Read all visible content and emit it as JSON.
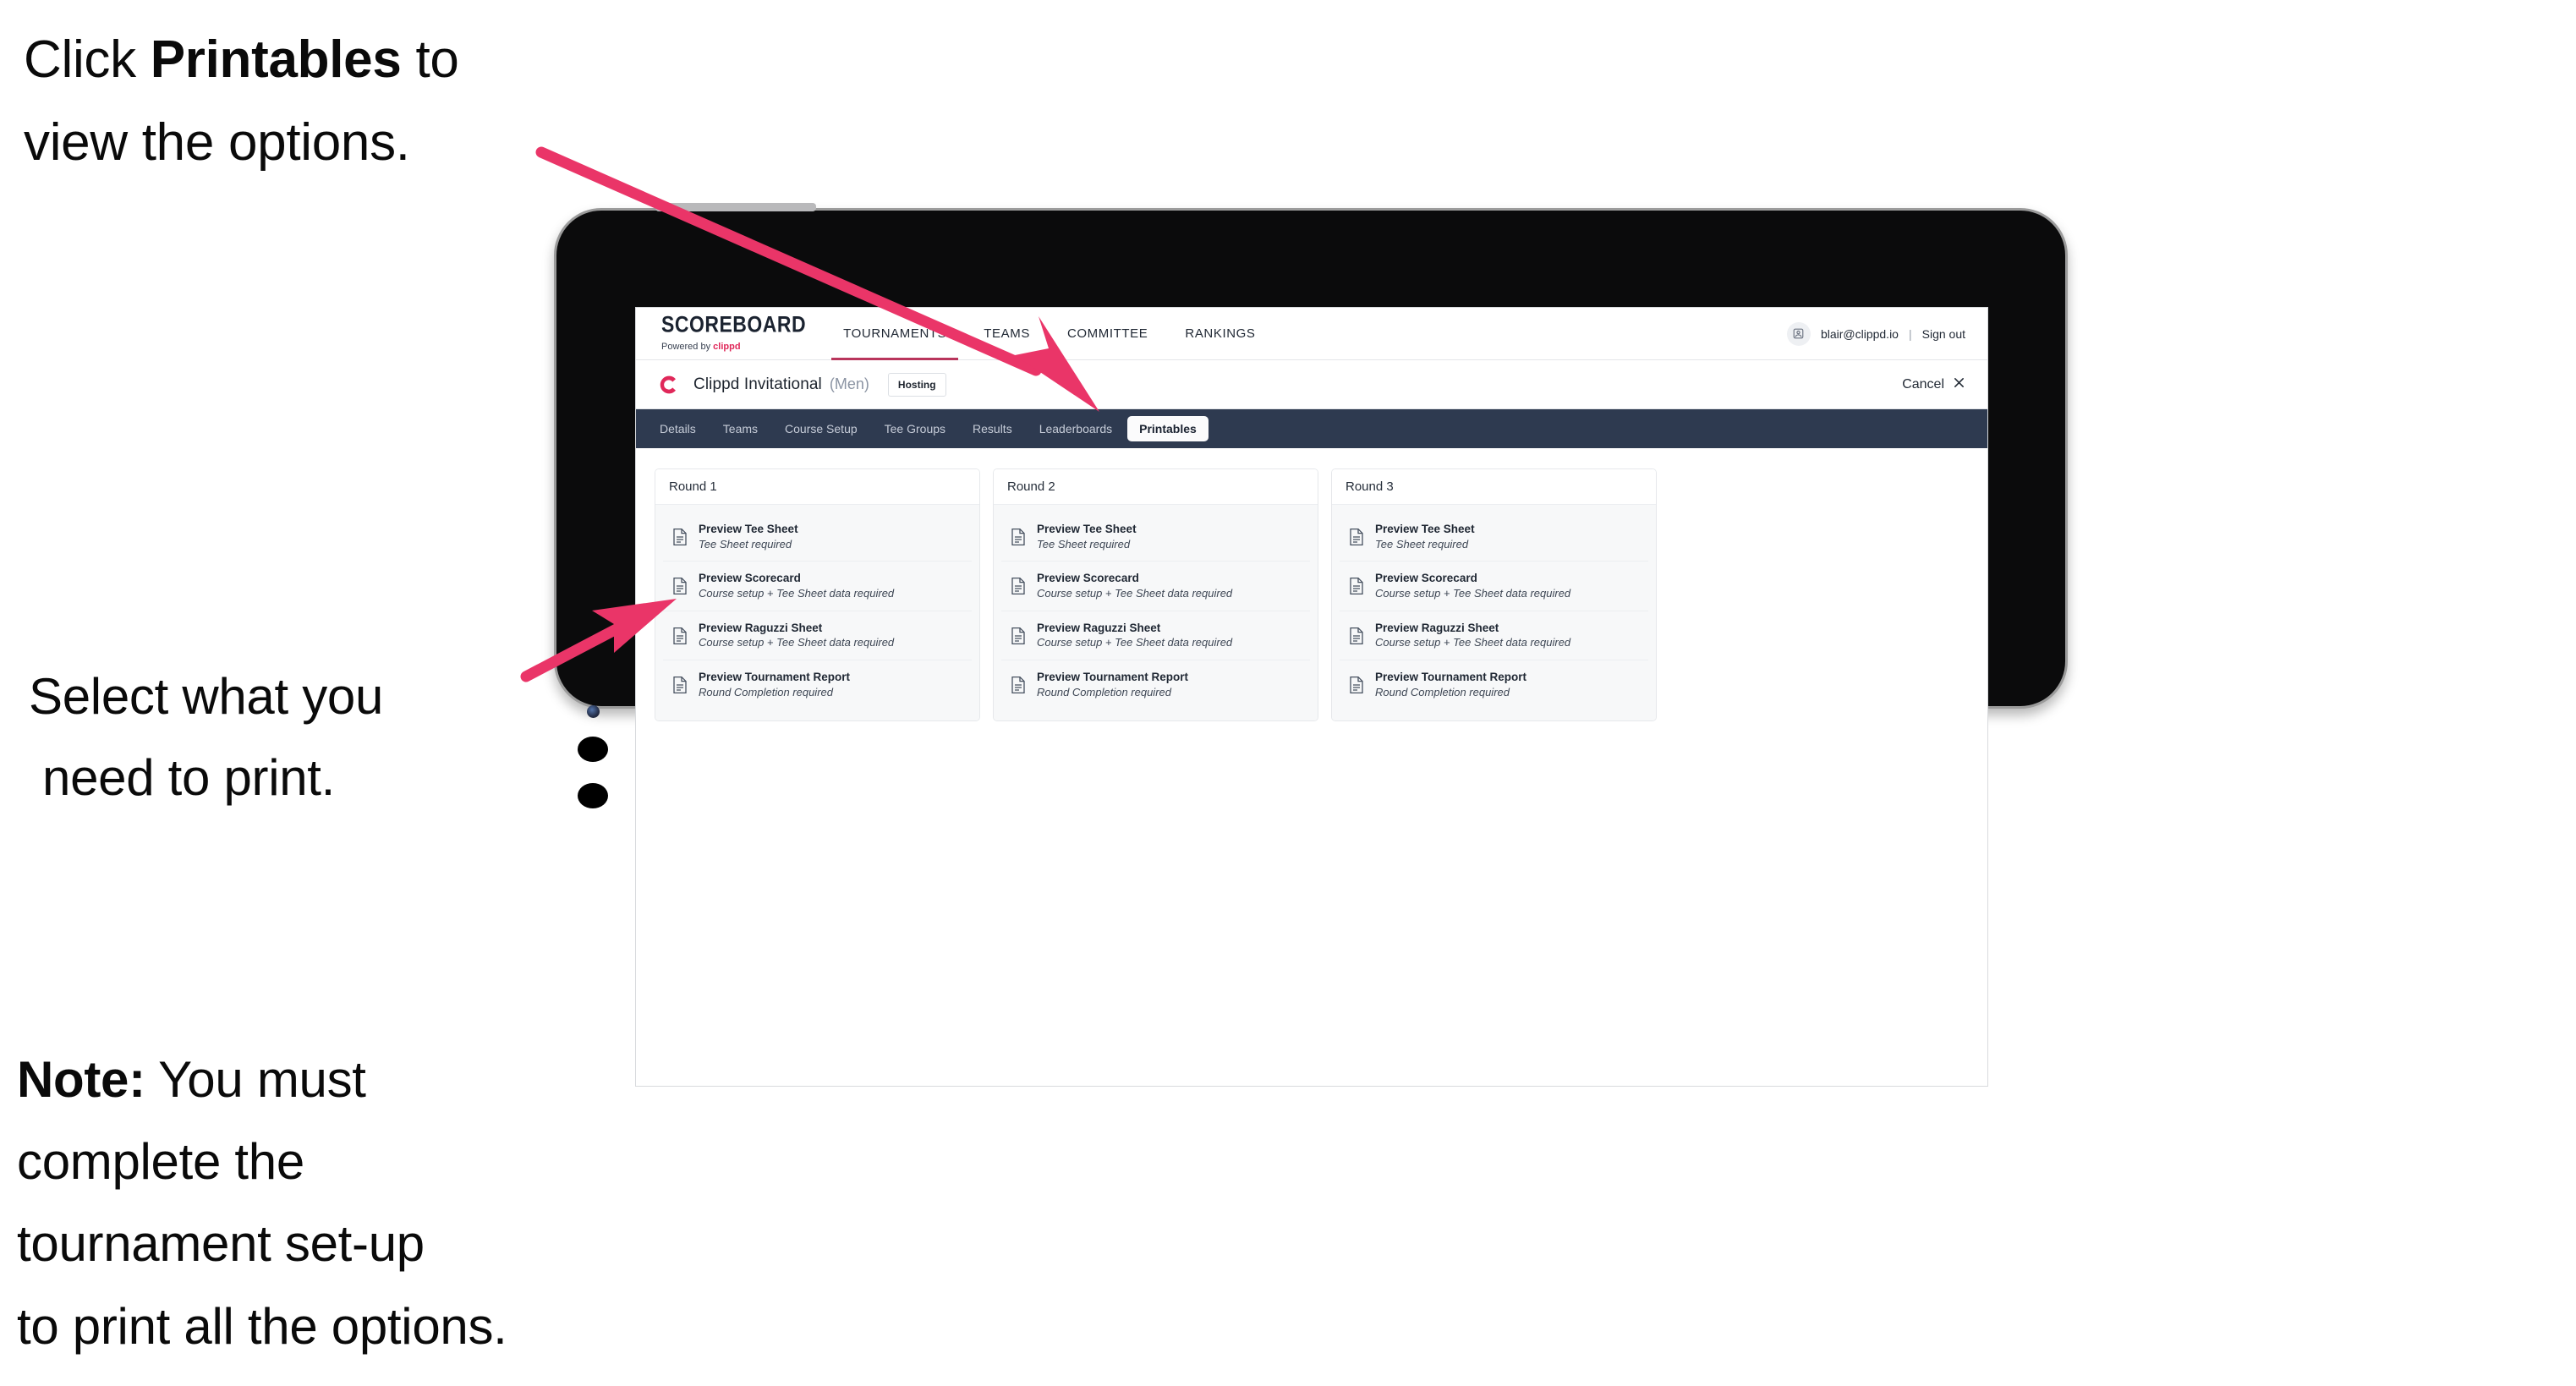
{
  "annotations": {
    "top": {
      "prefix": "Click ",
      "bold": "Printables",
      "suffix": " to",
      "line2": "view the options."
    },
    "middle": {
      "line1": "Select what you",
      "line2": "need to print."
    },
    "note": {
      "label": "Note:",
      "line1_rest": " You must",
      "line2": "complete the",
      "line3": "tournament set-up",
      "line4": "to print all the options."
    }
  },
  "app": {
    "brand": {
      "title": "SCOREBOARD",
      "sub_prefix": "Powered by ",
      "sub_brand": "clippd"
    },
    "top_nav": [
      {
        "label": "TOURNAMENTS",
        "active": true
      },
      {
        "label": "TEAMS",
        "active": false
      },
      {
        "label": "COMMITTEE",
        "active": false
      },
      {
        "label": "RANKINGS",
        "active": false
      }
    ],
    "account": {
      "email": "blair@clippd.io",
      "separator": "|",
      "sign_out": "Sign out",
      "avatar_icon": "user-avatar-icon"
    },
    "tournament": {
      "logo_icon": "clippd-c-logo-icon",
      "name": "Clippd Invitational",
      "gender": "(Men)",
      "badge": "Hosting",
      "cancel_label": "Cancel",
      "cancel_icon": "close-icon"
    },
    "tabs": [
      {
        "label": "Details",
        "active": false
      },
      {
        "label": "Teams",
        "active": false
      },
      {
        "label": "Course Setup",
        "active": false
      },
      {
        "label": "Tee Groups",
        "active": false
      },
      {
        "label": "Results",
        "active": false
      },
      {
        "label": "Leaderboards",
        "active": false
      },
      {
        "label": "Printables",
        "active": true
      }
    ],
    "rounds": [
      {
        "title": "Round 1",
        "items": [
          {
            "icon": "document-icon",
            "title": "Preview Tee Sheet",
            "sub": "Tee Sheet required"
          },
          {
            "icon": "document-icon",
            "title": "Preview Scorecard",
            "sub": "Course setup + Tee Sheet data required"
          },
          {
            "icon": "document-icon",
            "title": "Preview Raguzzi Sheet",
            "sub": "Course setup + Tee Sheet data required"
          },
          {
            "icon": "document-icon",
            "title": "Preview Tournament Report",
            "sub": "Round Completion required"
          }
        ]
      },
      {
        "title": "Round 2",
        "items": [
          {
            "icon": "document-icon",
            "title": "Preview Tee Sheet",
            "sub": "Tee Sheet required"
          },
          {
            "icon": "document-icon",
            "title": "Preview Scorecard",
            "sub": "Course setup + Tee Sheet data required"
          },
          {
            "icon": "document-icon",
            "title": "Preview Raguzzi Sheet",
            "sub": "Course setup + Tee Sheet data required"
          },
          {
            "icon": "document-icon",
            "title": "Preview Tournament Report",
            "sub": "Round Completion required"
          }
        ]
      },
      {
        "title": "Round 3",
        "items": [
          {
            "icon": "document-icon",
            "title": "Preview Tee Sheet",
            "sub": "Tee Sheet required"
          },
          {
            "icon": "document-icon",
            "title": "Preview Scorecard",
            "sub": "Course setup + Tee Sheet data required"
          },
          {
            "icon": "document-icon",
            "title": "Preview Raguzzi Sheet",
            "sub": "Course setup + Tee Sheet data required"
          },
          {
            "icon": "document-icon",
            "title": "Preview Tournament Report",
            "sub": "Round Completion required"
          }
        ]
      }
    ]
  },
  "colors": {
    "arrow_pink": "#ec २",
    "arrow": "#ea3568",
    "navbar": "#2e3a50",
    "brand_accent": "#e0285a",
    "tab_active_bg": "#fbfbfc",
    "page_bg": "#ffffff",
    "device_body": "#0b0b0c",
    "device_edge": "#9b9b9b"
  }
}
